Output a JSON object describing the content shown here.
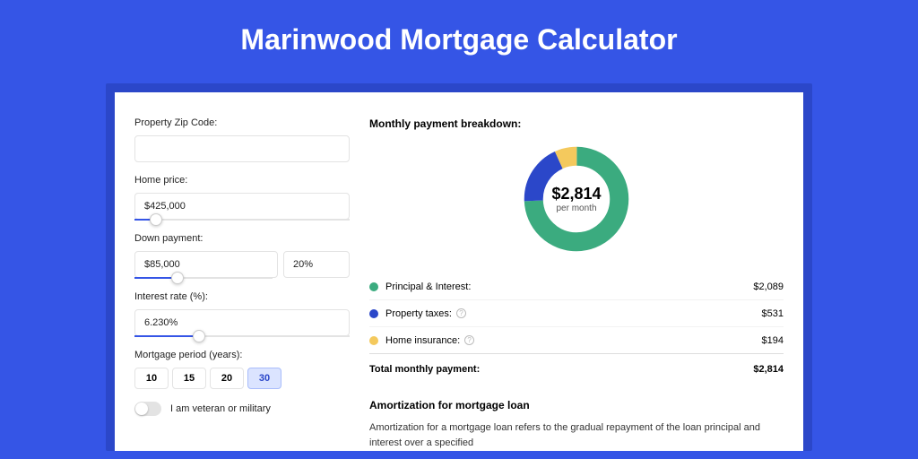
{
  "title": "Marinwood Mortgage Calculator",
  "form": {
    "zip": {
      "label": "Property Zip Code:",
      "value": ""
    },
    "price": {
      "label": "Home price:",
      "value": "$425,000",
      "slider_pct": 10
    },
    "down": {
      "label": "Down payment:",
      "value": "$85,000",
      "pct": "20%",
      "slider_pct": 20
    },
    "rate": {
      "label": "Interest rate (%):",
      "value": "6.230%",
      "slider_pct": 30
    },
    "period": {
      "label": "Mortgage period (years):",
      "options": [
        "10",
        "15",
        "20",
        "30"
      ],
      "active": "30"
    },
    "veteran": {
      "label": "I am veteran or military",
      "on": false
    }
  },
  "breakdown": {
    "title": "Monthly payment breakdown:",
    "center_amount": "$2,814",
    "center_sub": "per month",
    "items": [
      {
        "label": "Principal & Interest:",
        "value": "$2,089",
        "color": "#3bab7f",
        "info": false
      },
      {
        "label": "Property taxes:",
        "value": "$531",
        "color": "#2b47c9",
        "info": true
      },
      {
        "label": "Home insurance:",
        "value": "$194",
        "color": "#f4c95d",
        "info": true
      }
    ],
    "total": {
      "label": "Total monthly payment:",
      "value": "$2,814"
    }
  },
  "amort": {
    "title": "Amortization for mortgage loan",
    "text": "Amortization for a mortgage loan refers to the gradual repayment of the loan principal and interest over a specified"
  },
  "chart_data": {
    "type": "pie",
    "title": "Monthly payment breakdown",
    "series": [
      {
        "name": "Principal & Interest",
        "value": 2089,
        "color": "#3bab7f"
      },
      {
        "name": "Property taxes",
        "value": 531,
        "color": "#2b47c9"
      },
      {
        "name": "Home insurance",
        "value": 194,
        "color": "#f4c95d"
      }
    ],
    "total": 2814,
    "center_label": "$2,814 per month"
  }
}
